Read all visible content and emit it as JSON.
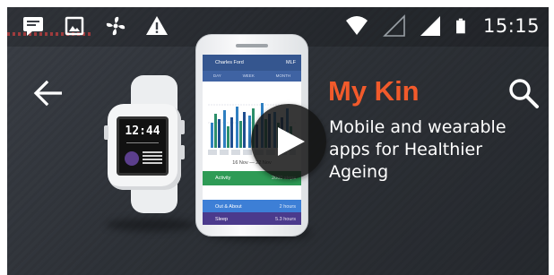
{
  "status_bar": {
    "time": "15:15",
    "left_icons": [
      "message-icon",
      "image-icon",
      "fan-icon",
      "warning-icon"
    ],
    "right_icons": [
      "wifi-icon",
      "signal-empty-icon",
      "signal-full-icon",
      "battery-icon"
    ]
  },
  "app_bar": {
    "back_icon": "arrow-back-icon",
    "search_icon": "search-icon"
  },
  "hero": {
    "title": "My Kin",
    "subtitle": "Mobile and wearable apps for Healthier Ageing",
    "title_color": "#f25a2b"
  },
  "watch": {
    "time": "12:44"
  },
  "phone": {
    "header_name": "Charles Ford",
    "header_right": "MLF",
    "tabs": [
      "DAY",
      "WEEK",
      "MONTH"
    ],
    "date_range": "16 Nov — 22 Nov",
    "rows": [
      {
        "label": "Activity",
        "value": "2000 steps"
      },
      {
        "label": "Out & About",
        "value": "2 hours"
      },
      {
        "label": "Sleep",
        "value": "5.3 hours"
      }
    ]
  },
  "video": {
    "play_icon": "play-icon"
  }
}
